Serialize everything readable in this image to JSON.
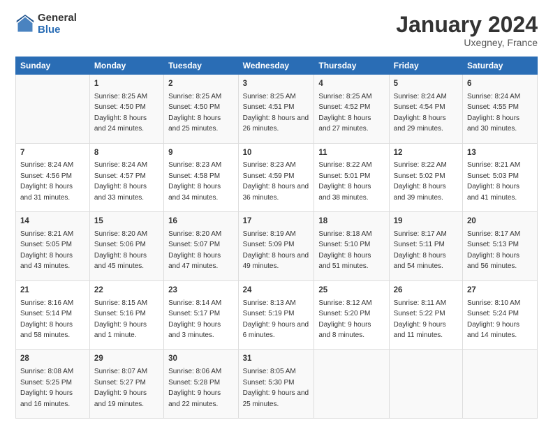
{
  "header": {
    "logo_general": "General",
    "logo_blue": "Blue",
    "title": "January 2024",
    "location": "Uxegney, France"
  },
  "calendar": {
    "weekdays": [
      "Sunday",
      "Monday",
      "Tuesday",
      "Wednesday",
      "Thursday",
      "Friday",
      "Saturday"
    ],
    "weeks": [
      [
        {
          "day": "",
          "sunrise": "",
          "sunset": "",
          "daylight": ""
        },
        {
          "day": "1",
          "sunrise": "Sunrise: 8:25 AM",
          "sunset": "Sunset: 4:50 PM",
          "daylight": "Daylight: 8 hours and 24 minutes."
        },
        {
          "day": "2",
          "sunrise": "Sunrise: 8:25 AM",
          "sunset": "Sunset: 4:50 PM",
          "daylight": "Daylight: 8 hours and 25 minutes."
        },
        {
          "day": "3",
          "sunrise": "Sunrise: 8:25 AM",
          "sunset": "Sunset: 4:51 PM",
          "daylight": "Daylight: 8 hours and 26 minutes."
        },
        {
          "day": "4",
          "sunrise": "Sunrise: 8:25 AM",
          "sunset": "Sunset: 4:52 PM",
          "daylight": "Daylight: 8 hours and 27 minutes."
        },
        {
          "day": "5",
          "sunrise": "Sunrise: 8:24 AM",
          "sunset": "Sunset: 4:54 PM",
          "daylight": "Daylight: 8 hours and 29 minutes."
        },
        {
          "day": "6",
          "sunrise": "Sunrise: 8:24 AM",
          "sunset": "Sunset: 4:55 PM",
          "daylight": "Daylight: 8 hours and 30 minutes."
        }
      ],
      [
        {
          "day": "7",
          "sunrise": "Sunrise: 8:24 AM",
          "sunset": "Sunset: 4:56 PM",
          "daylight": "Daylight: 8 hours and 31 minutes."
        },
        {
          "day": "8",
          "sunrise": "Sunrise: 8:24 AM",
          "sunset": "Sunset: 4:57 PM",
          "daylight": "Daylight: 8 hours and 33 minutes."
        },
        {
          "day": "9",
          "sunrise": "Sunrise: 8:23 AM",
          "sunset": "Sunset: 4:58 PM",
          "daylight": "Daylight: 8 hours and 34 minutes."
        },
        {
          "day": "10",
          "sunrise": "Sunrise: 8:23 AM",
          "sunset": "Sunset: 4:59 PM",
          "daylight": "Daylight: 8 hours and 36 minutes."
        },
        {
          "day": "11",
          "sunrise": "Sunrise: 8:22 AM",
          "sunset": "Sunset: 5:01 PM",
          "daylight": "Daylight: 8 hours and 38 minutes."
        },
        {
          "day": "12",
          "sunrise": "Sunrise: 8:22 AM",
          "sunset": "Sunset: 5:02 PM",
          "daylight": "Daylight: 8 hours and 39 minutes."
        },
        {
          "day": "13",
          "sunrise": "Sunrise: 8:21 AM",
          "sunset": "Sunset: 5:03 PM",
          "daylight": "Daylight: 8 hours and 41 minutes."
        }
      ],
      [
        {
          "day": "14",
          "sunrise": "Sunrise: 8:21 AM",
          "sunset": "Sunset: 5:05 PM",
          "daylight": "Daylight: 8 hours and 43 minutes."
        },
        {
          "day": "15",
          "sunrise": "Sunrise: 8:20 AM",
          "sunset": "Sunset: 5:06 PM",
          "daylight": "Daylight: 8 hours and 45 minutes."
        },
        {
          "day": "16",
          "sunrise": "Sunrise: 8:20 AM",
          "sunset": "Sunset: 5:07 PM",
          "daylight": "Daylight: 8 hours and 47 minutes."
        },
        {
          "day": "17",
          "sunrise": "Sunrise: 8:19 AM",
          "sunset": "Sunset: 5:09 PM",
          "daylight": "Daylight: 8 hours and 49 minutes."
        },
        {
          "day": "18",
          "sunrise": "Sunrise: 8:18 AM",
          "sunset": "Sunset: 5:10 PM",
          "daylight": "Daylight: 8 hours and 51 minutes."
        },
        {
          "day": "19",
          "sunrise": "Sunrise: 8:17 AM",
          "sunset": "Sunset: 5:11 PM",
          "daylight": "Daylight: 8 hours and 54 minutes."
        },
        {
          "day": "20",
          "sunrise": "Sunrise: 8:17 AM",
          "sunset": "Sunset: 5:13 PM",
          "daylight": "Daylight: 8 hours and 56 minutes."
        }
      ],
      [
        {
          "day": "21",
          "sunrise": "Sunrise: 8:16 AM",
          "sunset": "Sunset: 5:14 PM",
          "daylight": "Daylight: 8 hours and 58 minutes."
        },
        {
          "day": "22",
          "sunrise": "Sunrise: 8:15 AM",
          "sunset": "Sunset: 5:16 PM",
          "daylight": "Daylight: 9 hours and 1 minute."
        },
        {
          "day": "23",
          "sunrise": "Sunrise: 8:14 AM",
          "sunset": "Sunset: 5:17 PM",
          "daylight": "Daylight: 9 hours and 3 minutes."
        },
        {
          "day": "24",
          "sunrise": "Sunrise: 8:13 AM",
          "sunset": "Sunset: 5:19 PM",
          "daylight": "Daylight: 9 hours and 6 minutes."
        },
        {
          "day": "25",
          "sunrise": "Sunrise: 8:12 AM",
          "sunset": "Sunset: 5:20 PM",
          "daylight": "Daylight: 9 hours and 8 minutes."
        },
        {
          "day": "26",
          "sunrise": "Sunrise: 8:11 AM",
          "sunset": "Sunset: 5:22 PM",
          "daylight": "Daylight: 9 hours and 11 minutes."
        },
        {
          "day": "27",
          "sunrise": "Sunrise: 8:10 AM",
          "sunset": "Sunset: 5:24 PM",
          "daylight": "Daylight: 9 hours and 14 minutes."
        }
      ],
      [
        {
          "day": "28",
          "sunrise": "Sunrise: 8:08 AM",
          "sunset": "Sunset: 5:25 PM",
          "daylight": "Daylight: 9 hours and 16 minutes."
        },
        {
          "day": "29",
          "sunrise": "Sunrise: 8:07 AM",
          "sunset": "Sunset: 5:27 PM",
          "daylight": "Daylight: 9 hours and 19 minutes."
        },
        {
          "day": "30",
          "sunrise": "Sunrise: 8:06 AM",
          "sunset": "Sunset: 5:28 PM",
          "daylight": "Daylight: 9 hours and 22 minutes."
        },
        {
          "day": "31",
          "sunrise": "Sunrise: 8:05 AM",
          "sunset": "Sunset: 5:30 PM",
          "daylight": "Daylight: 9 hours and 25 minutes."
        },
        {
          "day": "",
          "sunrise": "",
          "sunset": "",
          "daylight": ""
        },
        {
          "day": "",
          "sunrise": "",
          "sunset": "",
          "daylight": ""
        },
        {
          "day": "",
          "sunrise": "",
          "sunset": "",
          "daylight": ""
        }
      ]
    ]
  }
}
